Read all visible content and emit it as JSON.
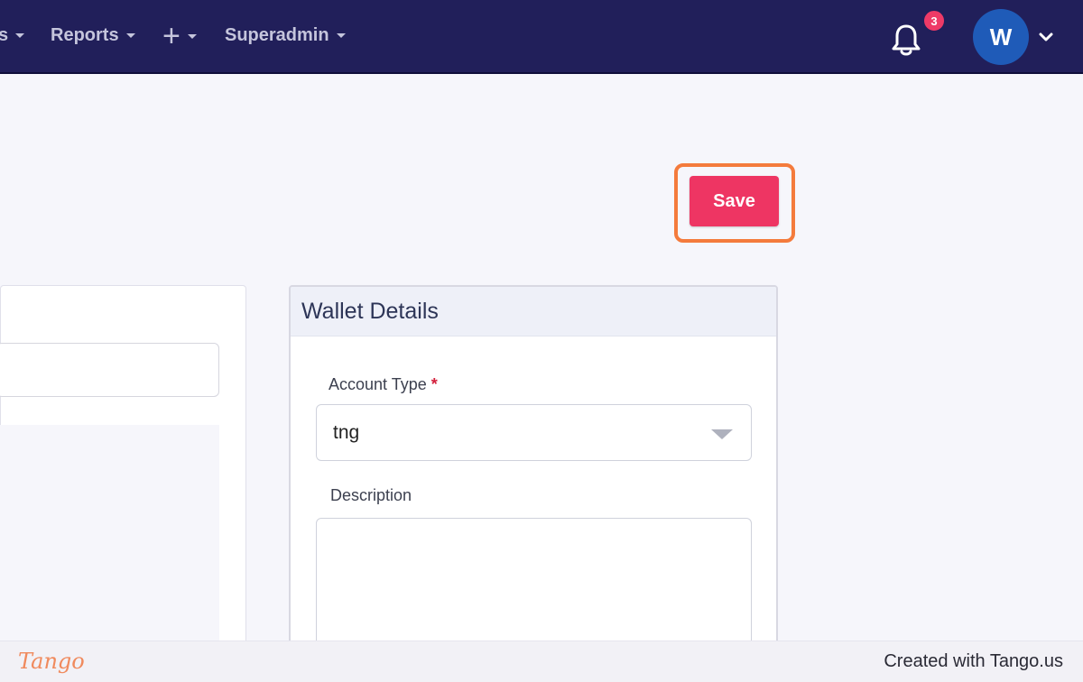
{
  "navbar": {
    "items": [
      {
        "label": "s"
      },
      {
        "label": "Reports"
      },
      {
        "label": "+"
      },
      {
        "label": "Superadmin"
      }
    ],
    "notification_count": "3",
    "avatar_initial": "W",
    "icons": [
      "bell-icon",
      "chevron-down-icon",
      "plus-icon"
    ]
  },
  "toolbar": {
    "save_label": "Save"
  },
  "wallet": {
    "title": "Wallet Details",
    "account_type_label": "Account Type",
    "required_mark": "*",
    "account_type_value": "tng",
    "description_label": "Description",
    "description_value": ""
  },
  "footer": {
    "logo": "Tango",
    "credit": "Created with Tango.us"
  },
  "colors": {
    "navbar": "#211f5a",
    "save_button": "#ee3563",
    "highlight": "#f47b3c",
    "badge": "#ee3a67",
    "avatar": "#1f5bb8"
  }
}
